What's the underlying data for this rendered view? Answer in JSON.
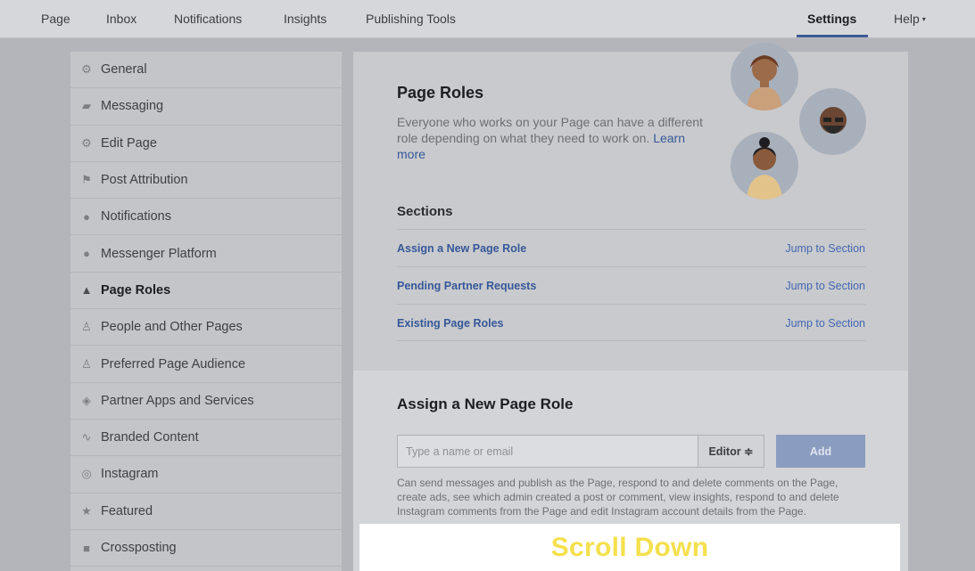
{
  "topnav": {
    "items": [
      "Page",
      "Inbox",
      "Notifications",
      "Insights",
      "Publishing Tools"
    ],
    "settings": "Settings",
    "help": "Help",
    "help_caret": "▾"
  },
  "sidebar": {
    "items": [
      {
        "label": "General",
        "icon": "gear-icon",
        "glyph": "⚙"
      },
      {
        "label": "Messaging",
        "icon": "chat-bubbles-icon",
        "glyph": "▰"
      },
      {
        "label": "Edit Page",
        "icon": "gear-icon",
        "glyph": "⚙"
      },
      {
        "label": "Post Attribution",
        "icon": "flag-icon",
        "glyph": "⚑"
      },
      {
        "label": "Notifications",
        "icon": "globe-icon",
        "glyph": "●"
      },
      {
        "label": "Messenger Platform",
        "icon": "messenger-icon",
        "glyph": "●"
      },
      {
        "label": "Page Roles",
        "icon": "person-icon",
        "glyph": "▲",
        "active": true
      },
      {
        "label": "People and Other Pages",
        "icon": "person-plus-icon",
        "glyph": "♙"
      },
      {
        "label": "Preferred Page Audience",
        "icon": "person-plus-icon",
        "glyph": "♙"
      },
      {
        "label": "Partner Apps and Services",
        "icon": "box-icon",
        "glyph": "◈"
      },
      {
        "label": "Branded Content",
        "icon": "handshake-icon",
        "glyph": "∿"
      },
      {
        "label": "Instagram",
        "icon": "instagram-icon",
        "glyph": "◎"
      },
      {
        "label": "Featured",
        "icon": "star-icon",
        "glyph": "★"
      },
      {
        "label": "Crossposting",
        "icon": "video-camera-icon",
        "glyph": "■"
      }
    ]
  },
  "page_roles": {
    "title": "Page Roles",
    "description": "Everyone who works on your Page can have a different role depending on what they need to work on.",
    "learn_more": "Learn more",
    "sections_label": "Sections",
    "sections": [
      {
        "name": "Assign a New Page Role",
        "jump": "Jump to Section"
      },
      {
        "name": "Pending Partner Requests",
        "jump": "Jump to Section"
      },
      {
        "name": "Existing Page Roles",
        "jump": "Jump to Section"
      }
    ]
  },
  "assign": {
    "title": "Assign a New Page Role",
    "placeholder": "Type a name or email",
    "role": "Editor ≑",
    "add": "Add",
    "help": "Can send messages and publish as the Page, respond to and delete comments on the Page, create ads, see which admin created a post or comment, view insights, respond to and delete Instagram comments from the Page and edit Instagram account details from the Page."
  },
  "overlay": {
    "text": "Scroll Down",
    "color": "#f4e04d"
  }
}
